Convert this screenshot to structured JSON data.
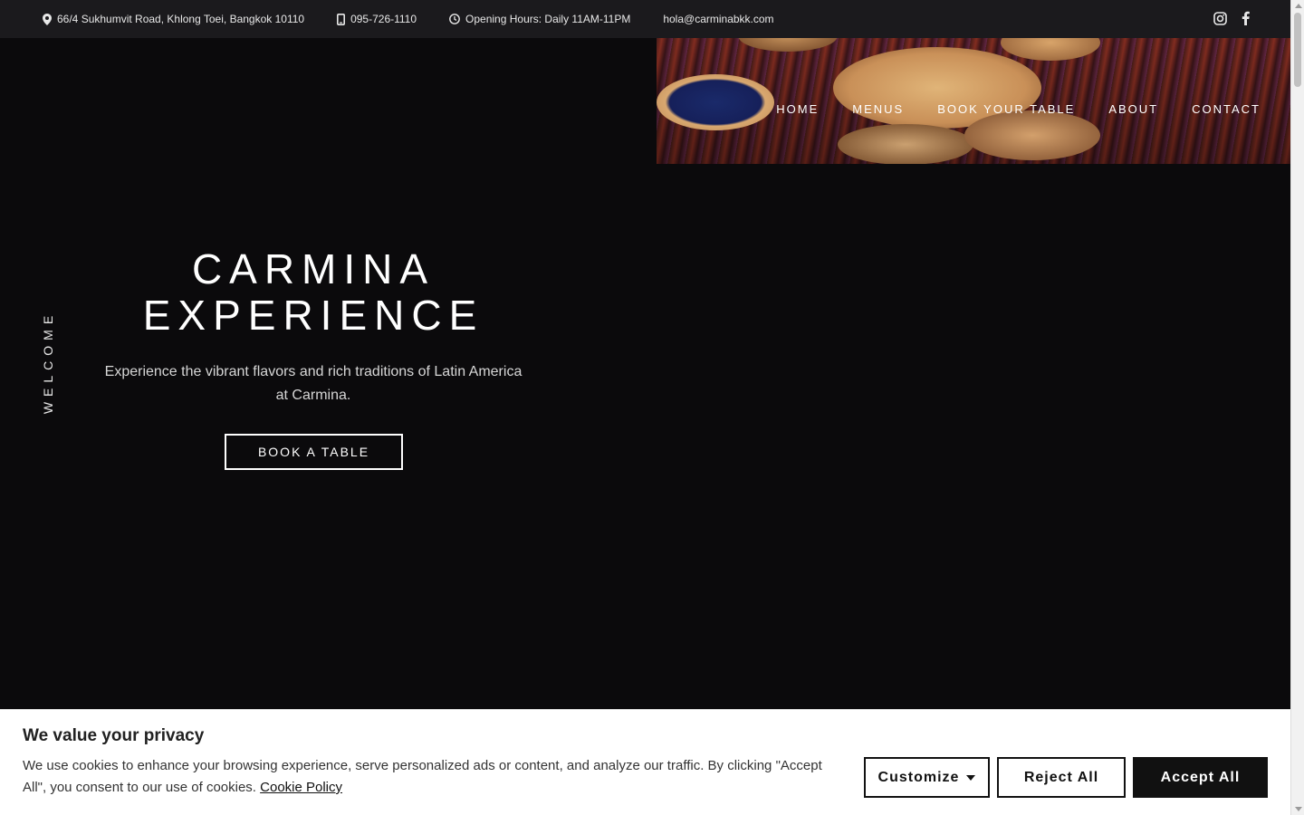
{
  "topbar": {
    "address": "66/4 Sukhumvit Road, Khlong Toei, Bangkok 10110",
    "phone": "095-726-1110",
    "hours": "Opening Hours: Daily 11AM-11PM",
    "email": "hola@carminabkk.com",
    "social_icons": [
      "instagram-icon",
      "facebook-icon"
    ]
  },
  "nav": {
    "items": [
      "HOME",
      "MENUS",
      "BOOK YOUR TABLE",
      "ABOUT",
      "CONTACT"
    ]
  },
  "hero": {
    "side_label": "WELCOME",
    "title_line1": "CARMINA",
    "title_line2": "EXPERIENCE",
    "subtitle": "Experience the vibrant flavors and rich traditions of Latin America at Carmina.",
    "cta_label": "BOOK A TABLE"
  },
  "cookie": {
    "title": "We value your privacy",
    "text": "We use cookies to enhance your browsing experience, serve personalized ads or content, and analyze our traffic. By clicking \"Accept All\", you consent to our use of cookies.",
    "link_label": "Cookie Policy",
    "customize_label": "Customize",
    "reject_label": "Reject All",
    "accept_label": "Accept All"
  },
  "colors": {
    "background": "#0b0a0c",
    "topbar": "#1b1a1d",
    "accent_photo": "#8a2f22"
  }
}
